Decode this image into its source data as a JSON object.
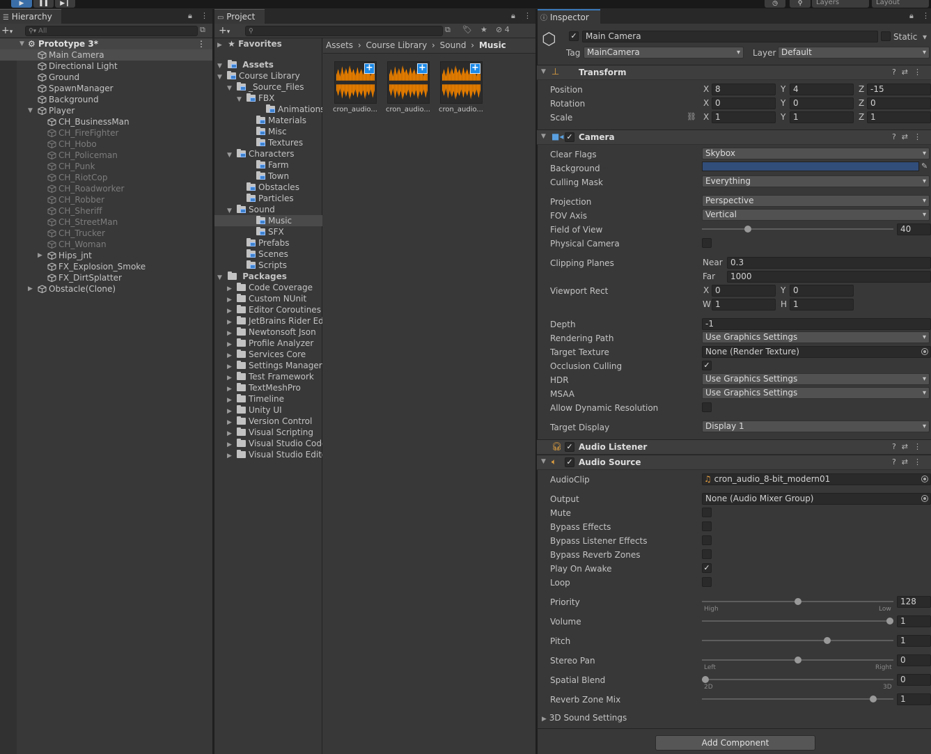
{
  "toolbar": {
    "layers": "Layers",
    "layout": "Layout"
  },
  "hierarchy": {
    "tab": "Hierarchy",
    "search_placeholder": "All",
    "scene": "Prototype 3*",
    "items": [
      {
        "label": "Main Camera"
      },
      {
        "label": "Directional Light"
      },
      {
        "label": "Ground"
      },
      {
        "label": "SpawnManager"
      },
      {
        "label": "Background"
      },
      {
        "label": "Player"
      },
      {
        "label": "CH_BusinessMan"
      },
      {
        "label": "CH_FireFighter"
      },
      {
        "label": "CH_Hobo"
      },
      {
        "label": "CH_Policeman"
      },
      {
        "label": "CH_Punk"
      },
      {
        "label": "CH_RiotCop"
      },
      {
        "label": "CH_Roadworker"
      },
      {
        "label": "CH_Robber"
      },
      {
        "label": "CH_Sheriff"
      },
      {
        "label": "CH_StreetMan"
      },
      {
        "label": "CH_Trucker"
      },
      {
        "label": "CH_Woman"
      },
      {
        "label": "Hips_jnt"
      },
      {
        "label": "FX_Explosion_Smoke"
      },
      {
        "label": "FX_DirtSplatter"
      },
      {
        "label": "Obstacle(Clone)"
      }
    ]
  },
  "project": {
    "tab": "Project",
    "hidden_count": "4",
    "favorites": "Favorites",
    "assets": "Assets",
    "packages": "Packages",
    "tree": [
      {
        "label": "Course Library"
      },
      {
        "label": "_Source_Files"
      },
      {
        "label": "FBX"
      },
      {
        "label": "Animations"
      },
      {
        "label": "Materials"
      },
      {
        "label": "Misc"
      },
      {
        "label": "Textures"
      },
      {
        "label": "Characters"
      },
      {
        "label": "Farm"
      },
      {
        "label": "Town"
      },
      {
        "label": "Obstacles"
      },
      {
        "label": "Particles"
      },
      {
        "label": "Sound"
      },
      {
        "label": "Music"
      },
      {
        "label": "SFX"
      },
      {
        "label": "Prefabs"
      },
      {
        "label": "Scenes"
      },
      {
        "label": "Scripts"
      }
    ],
    "package_list": [
      {
        "label": "Code Coverage"
      },
      {
        "label": "Custom NUnit"
      },
      {
        "label": "Editor Coroutines"
      },
      {
        "label": "JetBrains Rider Edit"
      },
      {
        "label": "Newtonsoft Json"
      },
      {
        "label": "Profile Analyzer"
      },
      {
        "label": "Services Core"
      },
      {
        "label": "Settings Manager"
      },
      {
        "label": "Test Framework"
      },
      {
        "label": "TextMeshPro"
      },
      {
        "label": "Timeline"
      },
      {
        "label": "Unity UI"
      },
      {
        "label": "Version Control"
      },
      {
        "label": "Visual Scripting"
      },
      {
        "label": "Visual Studio Code"
      },
      {
        "label": "Visual Studio Editor"
      }
    ],
    "breadcrumb": [
      "Assets",
      "Course Library",
      "Sound",
      "Music"
    ],
    "files": [
      {
        "label": "cron_audio..."
      },
      {
        "label": "cron_audio..."
      },
      {
        "label": "cron_audio..."
      }
    ]
  },
  "inspector": {
    "tab": "Inspector",
    "object_name": "Main Camera",
    "static_label": "Static",
    "tag_label": "Tag",
    "tag_value": "MainCamera",
    "layer_label": "Layer",
    "layer_value": "Default",
    "transform": {
      "title": "Transform",
      "position_label": "Position",
      "position": {
        "x": "8",
        "y": "4",
        "z": "-15"
      },
      "rotation_label": "Rotation",
      "rotation": {
        "x": "0",
        "y": "0",
        "z": "0"
      },
      "scale_label": "Scale",
      "scale": {
        "x": "1",
        "y": "1",
        "z": "1"
      }
    },
    "camera": {
      "title": "Camera",
      "clear_flags_label": "Clear Flags",
      "clear_flags": "Skybox",
      "background_label": "Background",
      "background_color": "#314d79",
      "culling_mask_label": "Culling Mask",
      "culling_mask": "Everything",
      "projection_label": "Projection",
      "projection": "Perspective",
      "fov_axis_label": "FOV Axis",
      "fov_axis": "Vertical",
      "fov_label": "Field of View",
      "fov": "40",
      "fov_fraction": 0.23,
      "physical_camera_label": "Physical Camera",
      "clipping_label": "Clipping Planes",
      "near_label": "Near",
      "near": "0.3",
      "far_label": "Far",
      "far": "1000",
      "viewport_label": "Viewport Rect",
      "vx": "0",
      "vy": "0",
      "vw": "1",
      "vh": "1",
      "depth_label": "Depth",
      "depth": "-1",
      "rendering_path_label": "Rendering Path",
      "rendering_path": "Use Graphics Settings",
      "target_texture_label": "Target Texture",
      "target_texture": "None (Render Texture)",
      "occlusion_label": "Occlusion Culling",
      "hdr_label": "HDR",
      "hdr": "Use Graphics Settings",
      "msaa_label": "MSAA",
      "msaa": "Use Graphics Settings",
      "dynamic_res_label": "Allow Dynamic Resolution",
      "target_display_label": "Target Display",
      "target_display": "Display 1"
    },
    "audio_listener": {
      "title": "Audio Listener"
    },
    "audio_source": {
      "title": "Audio Source",
      "clip_label": "AudioClip",
      "clip": "cron_audio_8-bit_modern01",
      "output_label": "Output",
      "output": "None (Audio Mixer Group)",
      "mute_label": "Mute",
      "bypass_effects_label": "Bypass Effects",
      "bypass_listener_label": "Bypass Listener Effects",
      "bypass_reverb_label": "Bypass Reverb Zones",
      "play_on_awake_label": "Play On Awake",
      "loop_label": "Loop",
      "priority_label": "Priority",
      "priority": "128",
      "priority_fraction": 0.5,
      "high_label": "High",
      "low_label": "Low",
      "volume_label": "Volume",
      "volume": "1",
      "volume_fraction": 1.0,
      "pitch_label": "Pitch",
      "pitch": "1",
      "pitch_fraction": 0.66,
      "stereo_label": "Stereo Pan",
      "stereo": "0",
      "stereo_fraction": 0.5,
      "left_label": "Left",
      "right_label": "Right",
      "spatial_label": "Spatial Blend",
      "spatial": "0",
      "spatial_fraction": 0.0,
      "label_2d": "2D",
      "label_3d": "3D",
      "reverb_label": "Reverb Zone Mix",
      "reverb": "1",
      "reverb_fraction": 0.91,
      "sound3d_label": "3D Sound Settings"
    },
    "add_component": "Add Component"
  }
}
